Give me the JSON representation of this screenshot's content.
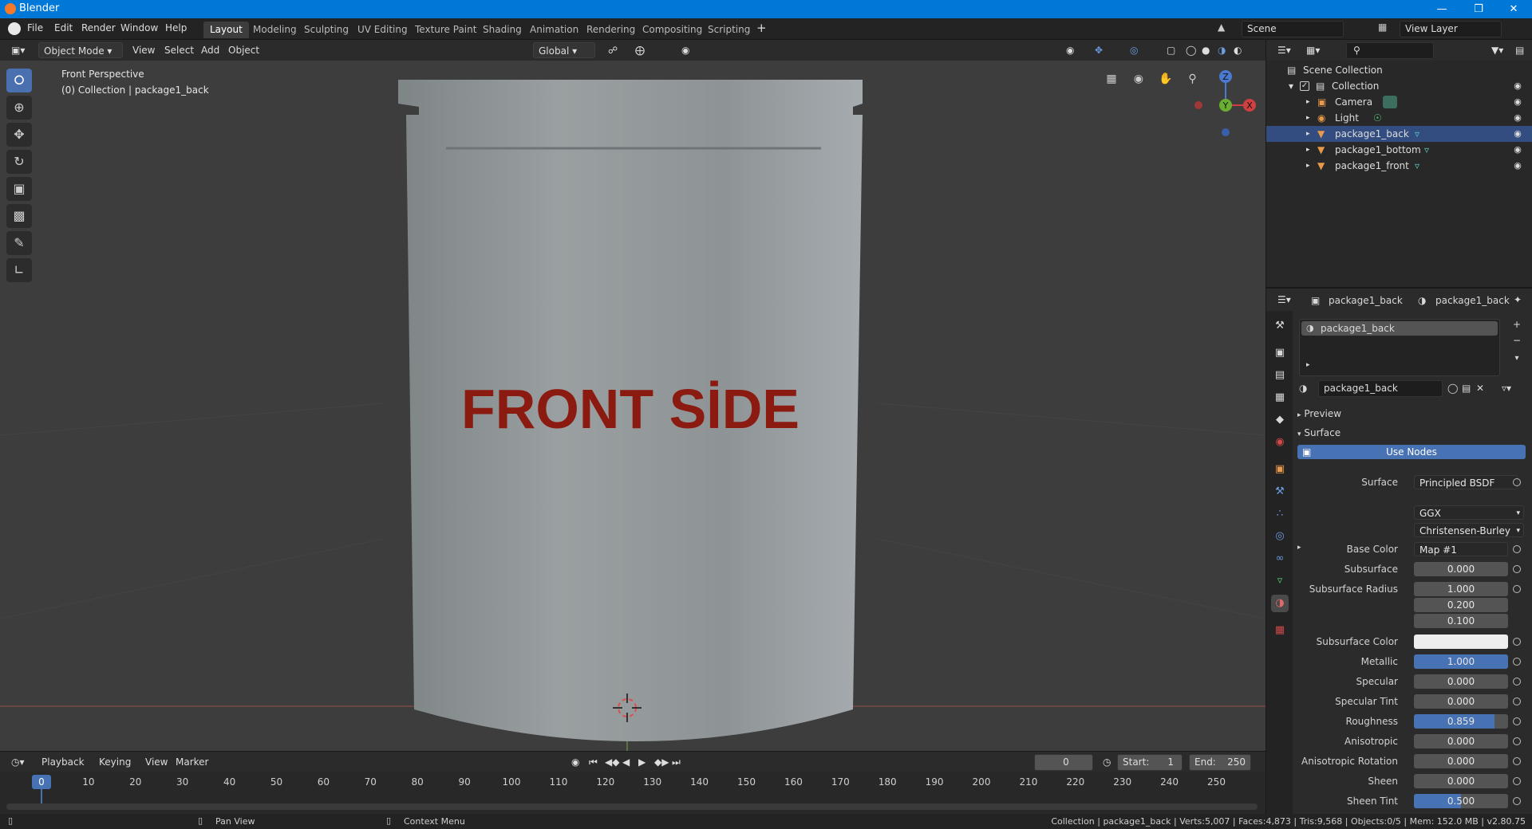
{
  "window": {
    "title": "Blender"
  },
  "menu": [
    "File",
    "Edit",
    "Render",
    "Window",
    "Help"
  ],
  "workspaces": [
    "Layout",
    "Modeling",
    "Sculpting",
    "UV Editing",
    "Texture Paint",
    "Shading",
    "Animation",
    "Rendering",
    "Compositing",
    "Scripting"
  ],
  "scene": {
    "name": "Scene",
    "view_layer": "View Layer"
  },
  "viewport": {
    "mode": "Object Mode",
    "menus": [
      "View",
      "Select",
      "Add",
      "Object"
    ],
    "orientation": "Global",
    "info_line1": "Front Perspective",
    "info_line2": "(0) Collection | package1_back",
    "package_text": "FRONT SİDE",
    "gizmo_axes": {
      "x": "X",
      "y": "Y",
      "z": "Z"
    }
  },
  "outliner": {
    "root": "Scene Collection",
    "collection": "Collection",
    "items": [
      "Camera",
      "Light",
      "package1_back",
      "package1_bottom",
      "package1_front"
    ],
    "selected": "package1_back"
  },
  "properties": {
    "object_name": "package1_back",
    "material_name": "package1_back",
    "slot": "package1_back",
    "datablock": "package1_back",
    "panels": {
      "preview": "Preview",
      "surface": "Surface"
    },
    "use_nodes": "Use Nodes",
    "surface_label": "Surface",
    "surface_value": "Principled BSDF",
    "distribution": "GGX",
    "subsurface_method": "Christensen-Burley",
    "fields": [
      {
        "label": "Base Color",
        "value": "Map #1"
      },
      {
        "label": "Subsurface",
        "value": "0.000"
      },
      {
        "label": "Subsurface Radius",
        "value": "1.000"
      },
      {
        "label": "",
        "value": "0.200"
      },
      {
        "label": "",
        "value": "0.100"
      },
      {
        "label": "Subsurface Color",
        "value": ""
      },
      {
        "label": "Metallic",
        "value": "1.000"
      },
      {
        "label": "Specular",
        "value": "0.000"
      },
      {
        "label": "Specular Tint",
        "value": "0.000"
      },
      {
        "label": "Roughness",
        "value": "0.859"
      },
      {
        "label": "Anisotropic",
        "value": "0.000"
      },
      {
        "label": "Anisotropic Rotation",
        "value": "0.000"
      },
      {
        "label": "Sheen",
        "value": "0.000"
      },
      {
        "label": "Sheen Tint",
        "value": "0.500"
      }
    ],
    "metallic_fill": 1.0,
    "roughness_fill": 0.859,
    "sheen_tint_fill": 0.5
  },
  "timeline": {
    "menus": [
      "Playback",
      "Keying",
      "View",
      "Marker"
    ],
    "current_frame": "0",
    "start_label": "Start:",
    "start": "1",
    "end_label": "End:",
    "end": "250",
    "ticks": [
      "0",
      "10",
      "20",
      "30",
      "40",
      "50",
      "60",
      "70",
      "80",
      "90",
      "100",
      "110",
      "120",
      "130",
      "140",
      "150",
      "160",
      "170",
      "180",
      "190",
      "200",
      "210",
      "220",
      "230",
      "240",
      "250"
    ]
  },
  "status": {
    "pan": "Pan View",
    "context": "Context Menu",
    "info": "Collection | package1_back | Verts:5,007 | Faces:4,873 | Tris:9,568 | Objects:0/5 | Mem: 152.0 MB | v2.80.75"
  },
  "colors": {
    "accent": "#4772b3",
    "selection": "#334d80",
    "label_red": "#8b1a10",
    "titlebar": "#0078d7"
  }
}
